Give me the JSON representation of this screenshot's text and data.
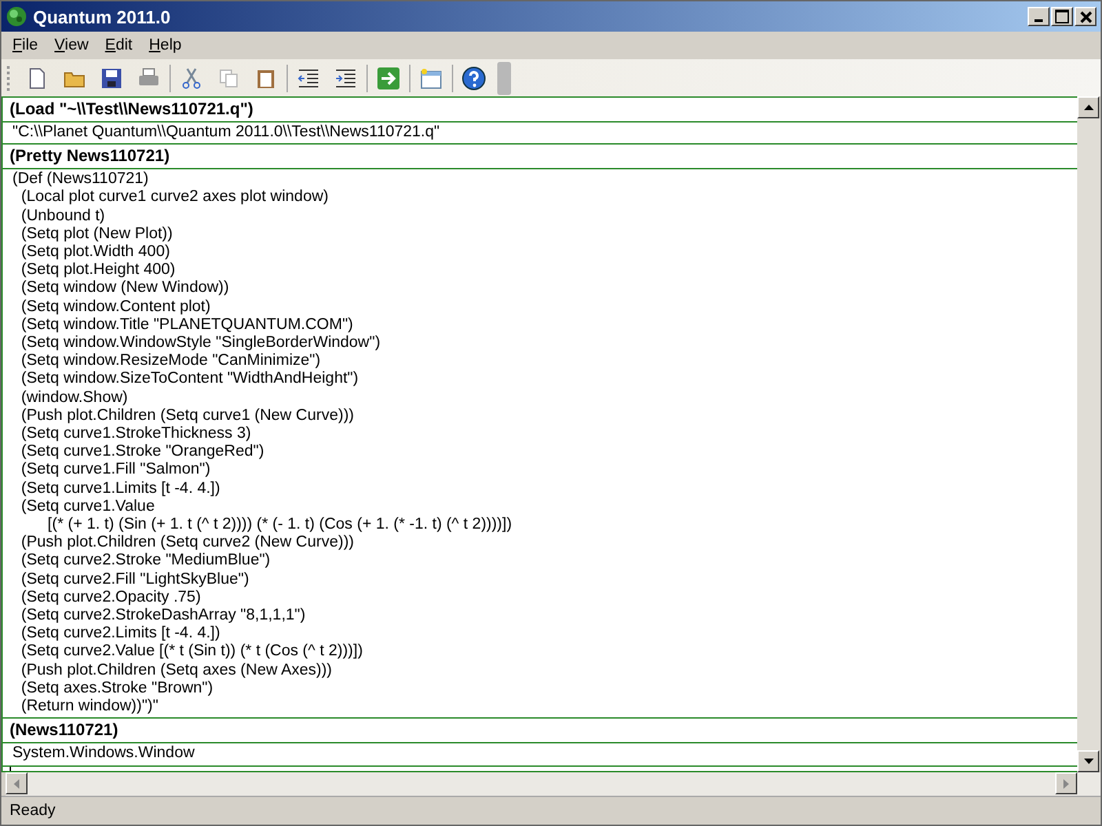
{
  "window": {
    "title": "Quantum 2011.0"
  },
  "menu": [
    {
      "label": "File"
    },
    {
      "label": "View"
    },
    {
      "label": "Edit"
    },
    {
      "label": "Help"
    }
  ],
  "cells": [
    {
      "kind": "input",
      "lines": [
        "(Load \"~\\\\Test\\\\News110721.q\")"
      ]
    },
    {
      "kind": "output",
      "lines": [
        "\"C:\\\\Planet Quantum\\\\Quantum 2011.0\\\\Test\\\\News110721.q\""
      ]
    },
    {
      "kind": "input",
      "lines": [
        "(Pretty News110721)"
      ]
    },
    {
      "kind": "output",
      "lines": [
        "(Def (News110721)",
        "  (Local plot curve1 curve2 axes plot window)",
        "  (Unbound t)",
        "  (Setq plot (New Plot))",
        "  (Setq plot.Width 400)",
        "  (Setq plot.Height 400)",
        "  (Setq window (New Window))",
        "  (Setq window.Content plot)",
        "  (Setq window.Title \"PLANETQUANTUM.COM\")",
        "  (Setq window.WindowStyle \"SingleBorderWindow\")",
        "  (Setq window.ResizeMode \"CanMinimize\")",
        "  (Setq window.SizeToContent \"WidthAndHeight\")",
        "  (window.Show)",
        "  (Push plot.Children (Setq curve1 (New Curve)))",
        "  (Setq curve1.StrokeThickness 3)",
        "  (Setq curve1.Stroke \"OrangeRed\")",
        "  (Setq curve1.Fill \"Salmon\")",
        "  (Setq curve1.Limits [t -4. 4.])",
        "  (Setq curve1.Value",
        "        [(* (+ 1. t) (Sin (+ 1. t (^ t 2)))) (* (- 1. t) (Cos (+ 1. (* -1. t) (^ t 2))))])",
        "  (Push plot.Children (Setq curve2 (New Curve)))",
        "  (Setq curve2.Stroke \"MediumBlue\")",
        "  (Setq curve2.Fill \"LightSkyBlue\")",
        "  (Setq curve2.Opacity .75)",
        "  (Setq curve2.StrokeDashArray \"8,1,1,1\")",
        "  (Setq curve2.Limits [t -4. 4.])",
        "  (Setq curve2.Value [(* t (Sin t)) (* t (Cos (^ t 2)))])",
        "  (Push plot.Children (Setq axes (New Axes)))",
        "  (Setq axes.Stroke \"Brown\")",
        "  (Return window))\")\""
      ]
    },
    {
      "kind": "input",
      "lines": [
        "(News110721)"
      ]
    },
    {
      "kind": "output",
      "lines": [
        "System.Windows.Window"
      ]
    }
  ],
  "status_bar": {
    "text": "Ready"
  }
}
